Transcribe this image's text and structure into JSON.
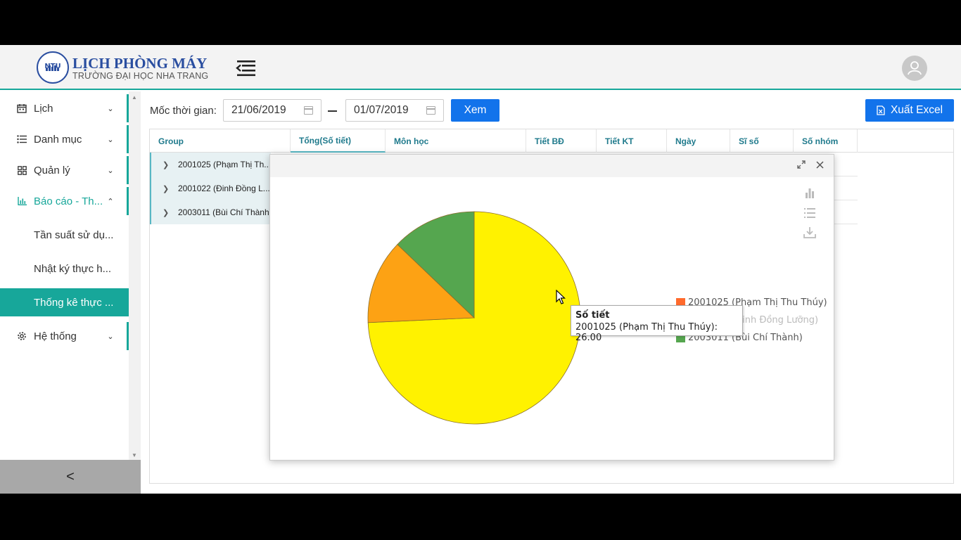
{
  "header": {
    "title": "LỊCH PHÒNG MÁY",
    "subtitle": "TRƯỜNG ĐẠI HỌC NHA TRANG",
    "logo_text": "NTU"
  },
  "sidebar": {
    "items": [
      {
        "label": "Lịch",
        "icon": "calendar-icon"
      },
      {
        "label": "Danh mục",
        "icon": "list-icon"
      },
      {
        "label": "Quản lý",
        "icon": "grid-icon"
      },
      {
        "label": "Báo cáo - Th...",
        "icon": "chart-icon"
      },
      {
        "label": "Hệ thống",
        "icon": "gear-icon"
      }
    ],
    "sub_items": [
      {
        "label": "Tần suất sử dụ..."
      },
      {
        "label": "Nhật ký thực h..."
      },
      {
        "label": "Thống kê thực ..."
      }
    ],
    "collapse_label": "<"
  },
  "toolbar": {
    "filter_label": "Mốc thời gian:",
    "date_from": "21/06/2019",
    "date_to": "01/07/2019",
    "view_button": "Xem",
    "export_button": "Xuất Excel"
  },
  "grid": {
    "columns": [
      "Group",
      "Tổng(Số tiết)",
      "Môn học",
      "Tiết BĐ",
      "Tiết KT",
      "Ngày",
      "Sĩ số",
      "Số nhóm"
    ],
    "rows": [
      {
        "group": "2001025 (Phạm Thị Th..."
      },
      {
        "group": "2001022 (Đinh Đồng L..."
      },
      {
        "group": "2003011 (Bùi Chí Thành)"
      }
    ]
  },
  "colors": {
    "accent": "#17a79a",
    "primary": "#1273eb",
    "slice_yellow": "#fff200",
    "slice_orange": "#fda214",
    "slice_green": "#55a64f",
    "legend_swatch_1": "#ff6a2c"
  },
  "chart_data": {
    "type": "pie",
    "series": [
      {
        "name": "2001025 (Phạm Thị Thu Thúy)",
        "value": 26
      },
      {
        "name": "2001022 (Đinh Đồng Lưỡng)",
        "value": 4.5
      },
      {
        "name": "2003011 (Bùi Chí Thành)",
        "value": 4.5
      }
    ],
    "legend": [
      "2001025 (Phạm Thị Thu Thúy)",
      "2001022 (Đinh Đồng Lưỡng)",
      "2003011 (Bùi Chí Thành)"
    ],
    "legend_placement": "right",
    "tooltip": {
      "title": "Số tiết",
      "text": "2001025 (Phạm Thị Thu Thúy): 26.00"
    }
  }
}
